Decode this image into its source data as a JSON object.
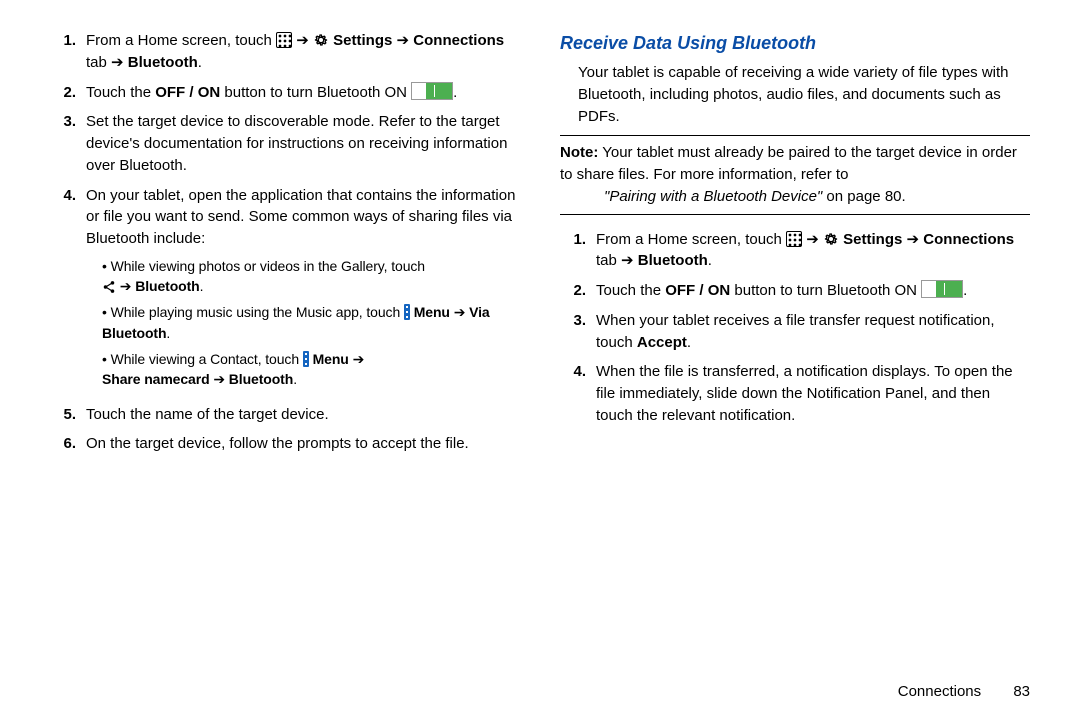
{
  "left": {
    "steps": [
      {
        "num": "1.",
        "pre": "From a Home screen, touch ",
        "settings": "Settings",
        "conn_tab": "Connections",
        "tab_word": " tab",
        "bt": "Bluetooth",
        "period": "."
      },
      {
        "num": "2.",
        "pre": "Touch the ",
        "offon": "OFF / ON",
        "mid": " button to turn Bluetooth ON ",
        "period": "."
      },
      {
        "num": "3.",
        "text": "Set the target device to discoverable mode. Refer to the target device's documentation for instructions on receiving information over Bluetooth."
      },
      {
        "num": "4.",
        "text": "On your tablet, open the application that contains the information or file you want to send. Some common ways of sharing files via Bluetooth include:",
        "bullets": [
          {
            "lead": "While viewing photos or videos in the Gallery, touch ",
            "bt": "Bluetooth",
            "period": "."
          },
          {
            "lead": "While playing music using the Music app, touch ",
            "menu": "Menu",
            "via": "Via Bluetooth",
            "period": "."
          },
          {
            "lead": "While viewing a Contact, touch ",
            "menu": "Menu",
            "share": "Share namecard",
            "bt": "Bluetooth",
            "period": "."
          }
        ]
      },
      {
        "num": "5.",
        "text": "Touch the name of the target device."
      },
      {
        "num": "6.",
        "text": "On the target device, follow the prompts to accept the file."
      }
    ]
  },
  "right": {
    "heading": "Receive Data Using Bluetooth",
    "intro": "Your tablet is capable of receiving a wide variety of file types with Bluetooth, including photos, audio files, and documents such as PDFs.",
    "note_label": "Note:",
    "note_text": " Your tablet must already be paired to the target device in order to share files. For more information, refer to ",
    "note_ref": "\"Pairing with a Bluetooth Device\"",
    "note_tail": " on page 80.",
    "steps": [
      {
        "num": "1.",
        "pre": "From a Home screen, touch ",
        "settings": "Settings",
        "conn_tab": "Connections",
        "tab_word": " tab",
        "bt": "Bluetooth",
        "period": "."
      },
      {
        "num": "2.",
        "pre": "Touch the ",
        "offon": "OFF / ON",
        "mid": " button to turn Bluetooth ON ",
        "period": "."
      },
      {
        "num": "3.",
        "pre": "When your tablet receives a file transfer request notification, touch ",
        "accept": "Accept",
        "period": "."
      },
      {
        "num": "4.",
        "text": "When the file is transferred, a notification displays. To open the file immediately, slide down the Notification Panel, and then touch the relevant notification."
      }
    ]
  },
  "footer": {
    "section": "Connections",
    "page": "83"
  }
}
